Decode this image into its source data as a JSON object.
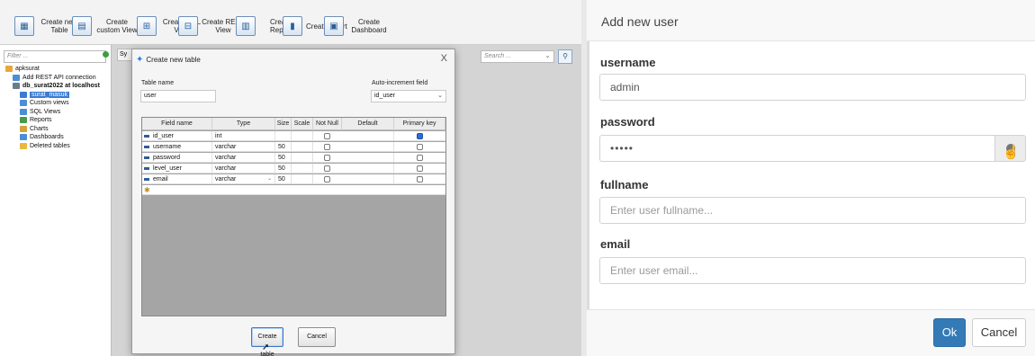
{
  "left": {
    "toolbar": [
      {
        "label": "Create new Table",
        "icon": "table-icon"
      },
      {
        "label": "Create custom View",
        "icon": "custom-view-icon"
      },
      {
        "label": "Create SQL View",
        "icon": "sql-view-icon"
      },
      {
        "label": "Create REST View",
        "icon": "rest-view-icon"
      },
      {
        "label": "Create Report",
        "icon": "report-icon"
      },
      {
        "label": "Create Chart",
        "icon": "chart-icon"
      },
      {
        "label": "Create Dashboard",
        "icon": "dashboard-icon"
      }
    ],
    "filter_placeholder": "Filter ...",
    "search_placeholder": "Search ...",
    "tab_label": "Sy",
    "tree": [
      {
        "label": "apksurat",
        "level": 0,
        "bold": false,
        "selected": false,
        "icon_color": "#e8a73b"
      },
      {
        "label": "Add REST API connection",
        "level": 1,
        "bold": false,
        "selected": false,
        "icon_color": "#4a8fd6"
      },
      {
        "label": "db_surat2022 at localhost",
        "level": 1,
        "bold": true,
        "selected": false,
        "icon_color": "#6b7d8c"
      },
      {
        "label": "surat_masuk",
        "level": 2,
        "bold": false,
        "selected": true,
        "icon_color": "#3a7bd5"
      },
      {
        "label": "Custom views",
        "level": 2,
        "bold": false,
        "selected": false,
        "icon_color": "#4a8fd6"
      },
      {
        "label": "SQL Views",
        "level": 2,
        "bold": false,
        "selected": false,
        "icon_color": "#4a8fd6"
      },
      {
        "label": "Reports",
        "level": 2,
        "bold": false,
        "selected": false,
        "icon_color": "#4a9a4a"
      },
      {
        "label": "Charts",
        "level": 2,
        "bold": false,
        "selected": false,
        "icon_color": "#d6a23a"
      },
      {
        "label": "Dashboards",
        "level": 2,
        "bold": false,
        "selected": false,
        "icon_color": "#4a8fd6"
      },
      {
        "label": "Deleted tables",
        "level": 2,
        "bold": false,
        "selected": false,
        "icon_color": "#e8b93b"
      }
    ],
    "dialog": {
      "title": "Create new table",
      "close": "X",
      "table_name_label": "Table name",
      "table_name_value": "user",
      "auto_inc_label": "Auto-increment field",
      "auto_inc_value": "id_user",
      "columns": [
        "Field name",
        "Type",
        "Size",
        "Scale",
        "Not Null",
        "Default",
        "Primary key"
      ],
      "rows": [
        {
          "field": "id_user",
          "type": "int",
          "size": "",
          "scale": "",
          "not_null": false,
          "default": "",
          "primary": true
        },
        {
          "field": "username",
          "type": "varchar",
          "size": "50",
          "scale": "",
          "not_null": false,
          "default": "",
          "primary": false
        },
        {
          "field": "password",
          "type": "varchar",
          "size": "50",
          "scale": "",
          "not_null": false,
          "default": "",
          "primary": false
        },
        {
          "field": "level_user",
          "type": "varchar",
          "size": "50",
          "scale": "",
          "not_null": false,
          "default": "",
          "primary": false
        },
        {
          "field": "email",
          "type": "varchar",
          "size": "50",
          "scale": "",
          "not_null": false,
          "default": "",
          "primary": false
        }
      ],
      "create_button": "Create table",
      "cancel_button": "Cancel"
    }
  },
  "right": {
    "title": "Add new user",
    "fields": {
      "username_label": "username",
      "username_value": "admin",
      "password_label": "password",
      "password_value": "•••••",
      "fullname_label": "fullname",
      "fullname_placeholder": "Enter user fullname...",
      "email_label": "email",
      "email_placeholder": "Enter user email..."
    },
    "ok_button": "Ok",
    "cancel_button": "Cancel",
    "accent_color": "#337ab7"
  }
}
